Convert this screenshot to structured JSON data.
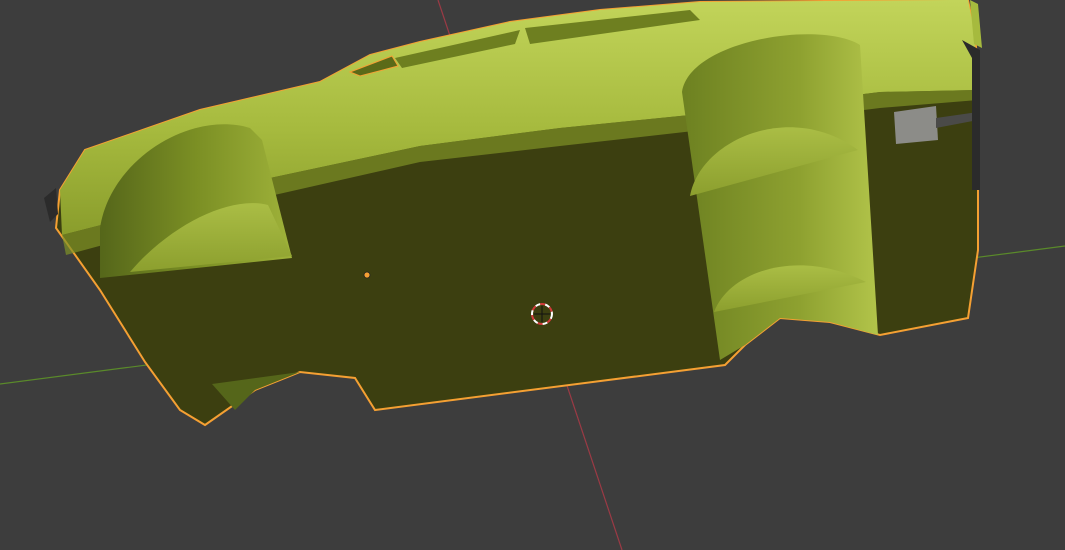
{
  "app": {
    "name": ""
  },
  "viewport": {
    "background_color": "#3d3d3d",
    "x_axis_color": "#9b3a45",
    "y_axis_color": "#5a8a2a",
    "selection_outline_color": "#f5a033",
    "object_origin_color": "#f5a033",
    "cursor_ring_colors": [
      "#ffffff",
      "#d23a3a"
    ]
  },
  "object": {
    "name": "",
    "selected": true,
    "body_color_light": "#b7c94a",
    "body_color_mid": "#8ea130",
    "body_color_dark": "#3c3f10",
    "wheel_well_color": "#667a1e",
    "accessory_color": "#8c8c88"
  }
}
